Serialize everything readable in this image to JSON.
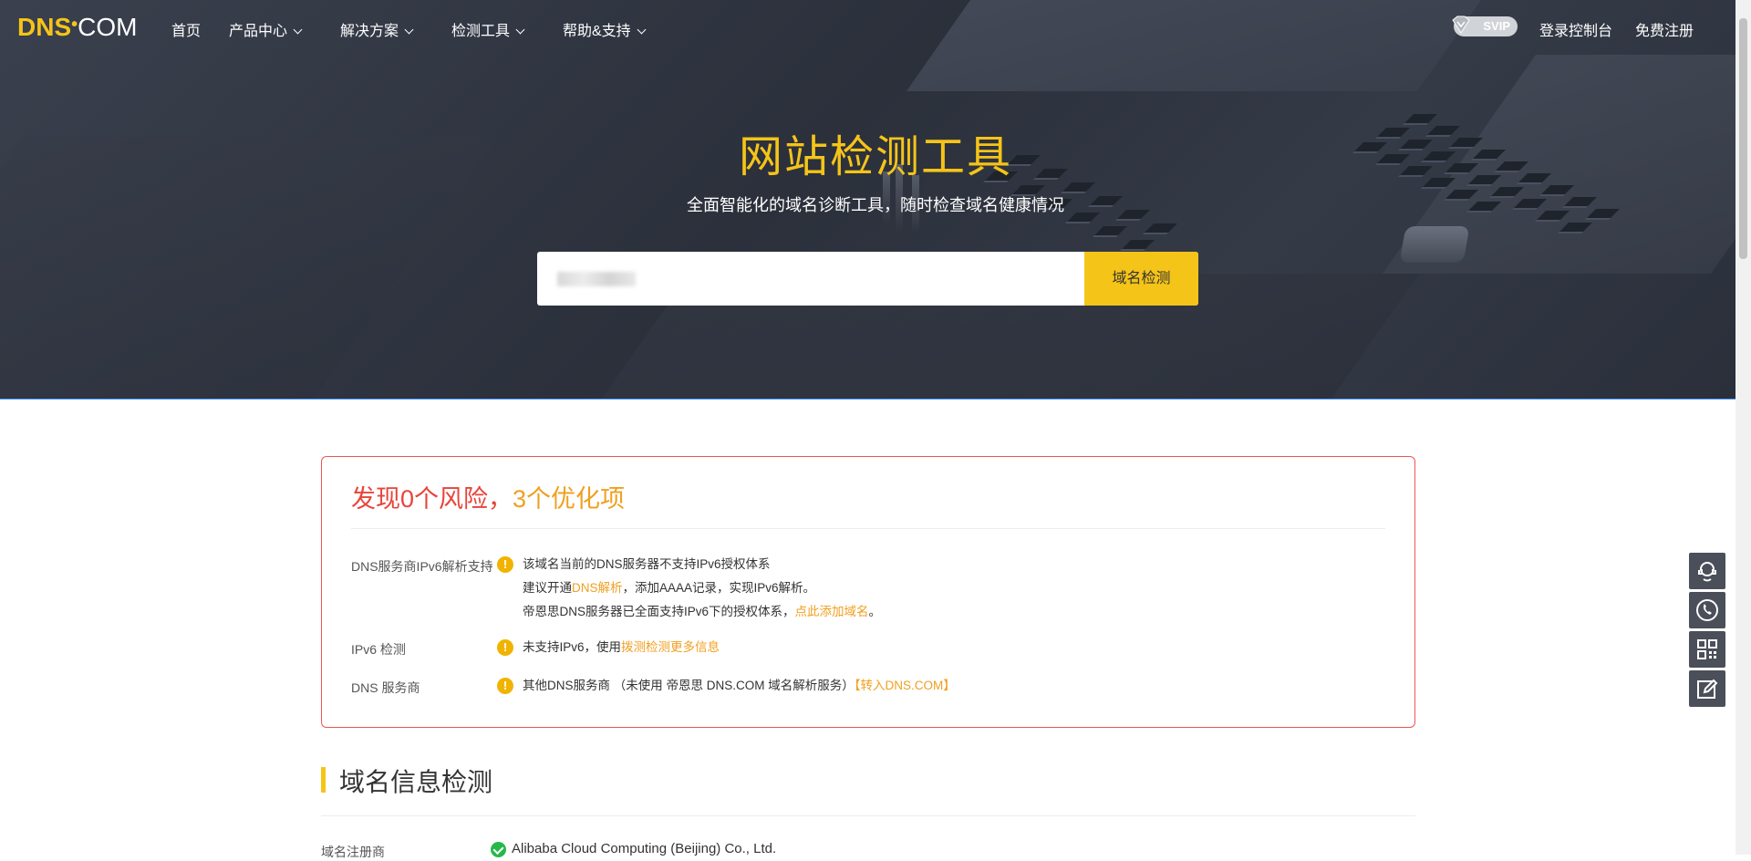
{
  "nav": {
    "logo_bold": "DNS",
    "logo_light": "COM",
    "items": [
      {
        "label": "首页"
      },
      {
        "label": "产品中心"
      },
      {
        "label": "解决方案"
      },
      {
        "label": "检测工具"
      },
      {
        "label": "帮助&支持"
      }
    ],
    "svip": "SVIP",
    "console": "登录控制台",
    "register": "免费注册"
  },
  "hero": {
    "title": "网站检测工具",
    "subtitle": "全面智能化的域名诊断工具，随时检查域名健康情况",
    "search_button": "域名检测"
  },
  "risk": {
    "title_risk": "发现0个风险，",
    "title_opt": "3个优化项",
    "rows": [
      {
        "label": "DNS服务商IPv6解析支持",
        "line1": "该域名当前的DNS服务器不支持IPv6授权体系",
        "line2_a": "建议开通",
        "line2_link": "DNS解析",
        "line2_b": "，添加AAAA记录，实现IPv6解析。",
        "line3_a": "帝恩思DNS服务器已全面支持IPv6下的授权体系，",
        "line3_link": "点此添加域名",
        "line3_b": "。"
      },
      {
        "label": "IPv6 检测",
        "text_a": "未支持IPv6，使用",
        "text_link": "拨测检测更多信息"
      },
      {
        "label": "DNS 服务商",
        "text_a": "其他DNS服务商 （未使用 帝恩思 DNS.COM 域名解析服务）",
        "text_link": "【转入DNS.COM】"
      }
    ]
  },
  "domain_info": {
    "title": "域名信息检测",
    "registrar_label": "域名注册商",
    "registrar_value": "Alibaba Cloud Computing (Beijing) Co., Ltd."
  },
  "side_tools": [
    "customer-service-icon",
    "phone-icon",
    "qrcode-icon",
    "edit-icon"
  ],
  "colors": {
    "accent": "#f5c418",
    "risk": "#e8443a",
    "warning": "#f0a020",
    "ok": "#27b84a"
  }
}
